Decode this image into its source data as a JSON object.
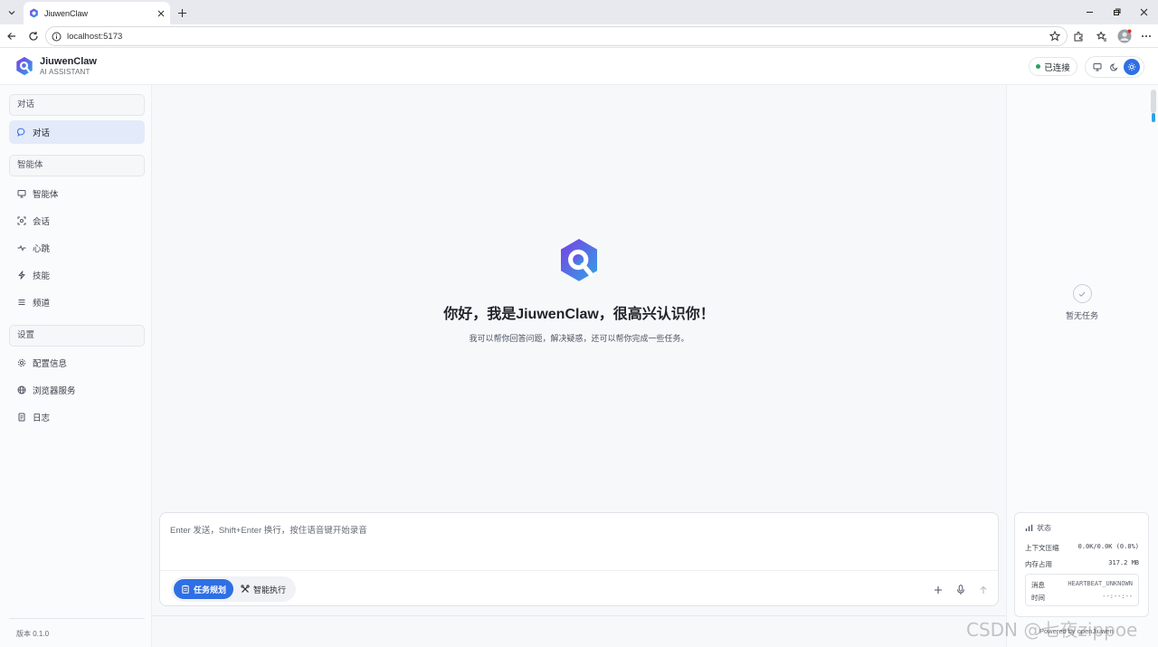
{
  "browser": {
    "tab_title": "JiuwenClaw",
    "url": "localhost:5173"
  },
  "header": {
    "brand_name": "JiuwenClaw",
    "brand_sub": "AI ASSISTANT",
    "connection_status": "已连接",
    "theme_selected": "light"
  },
  "sidebar": {
    "section_chat": "对话",
    "item_chat": "对话",
    "section_agent": "智能体",
    "items_agent": [
      "智能体",
      "会话",
      "心跳",
      "技能",
      "频道"
    ],
    "section_settings": "设置",
    "items_settings": [
      "配置信息",
      "浏览器服务",
      "日志"
    ],
    "version": "版本 0.1.0"
  },
  "main": {
    "welcome_title": "你好，我是JiuwenClaw，很高兴认识你！",
    "welcome_sub": "我可以帮你回答问题，解决疑惑，还可以帮你完成一些任务。",
    "input_placeholder": "Enter 发送，Shift+Enter 换行，按住语音键开始录音",
    "mode_plan": "任务规划",
    "mode_exec": "智能执行",
    "mode_selected": "任务规划"
  },
  "right_panel": {
    "empty_text": "暂无任务",
    "status_title": "状态",
    "context_label": "上下文压缩",
    "context_value": "0.0K/0.0K (0.0%)",
    "memory_label": "内存占用",
    "memory_value": "317.2 MB",
    "message_label": "消息",
    "message_value": "HEARTBEAT_UNKNOWN",
    "time_label": "时间",
    "time_value": "--:--:--",
    "powered": "Powered by openJiuwen"
  },
  "watermark": "CSDN @七夜zippoe",
  "colors": {
    "accent": "#2f6fe4",
    "connected": "#22a55b",
    "logo_gradient_start": "#7b3fe4",
    "logo_gradient_end": "#2fa3e6"
  }
}
